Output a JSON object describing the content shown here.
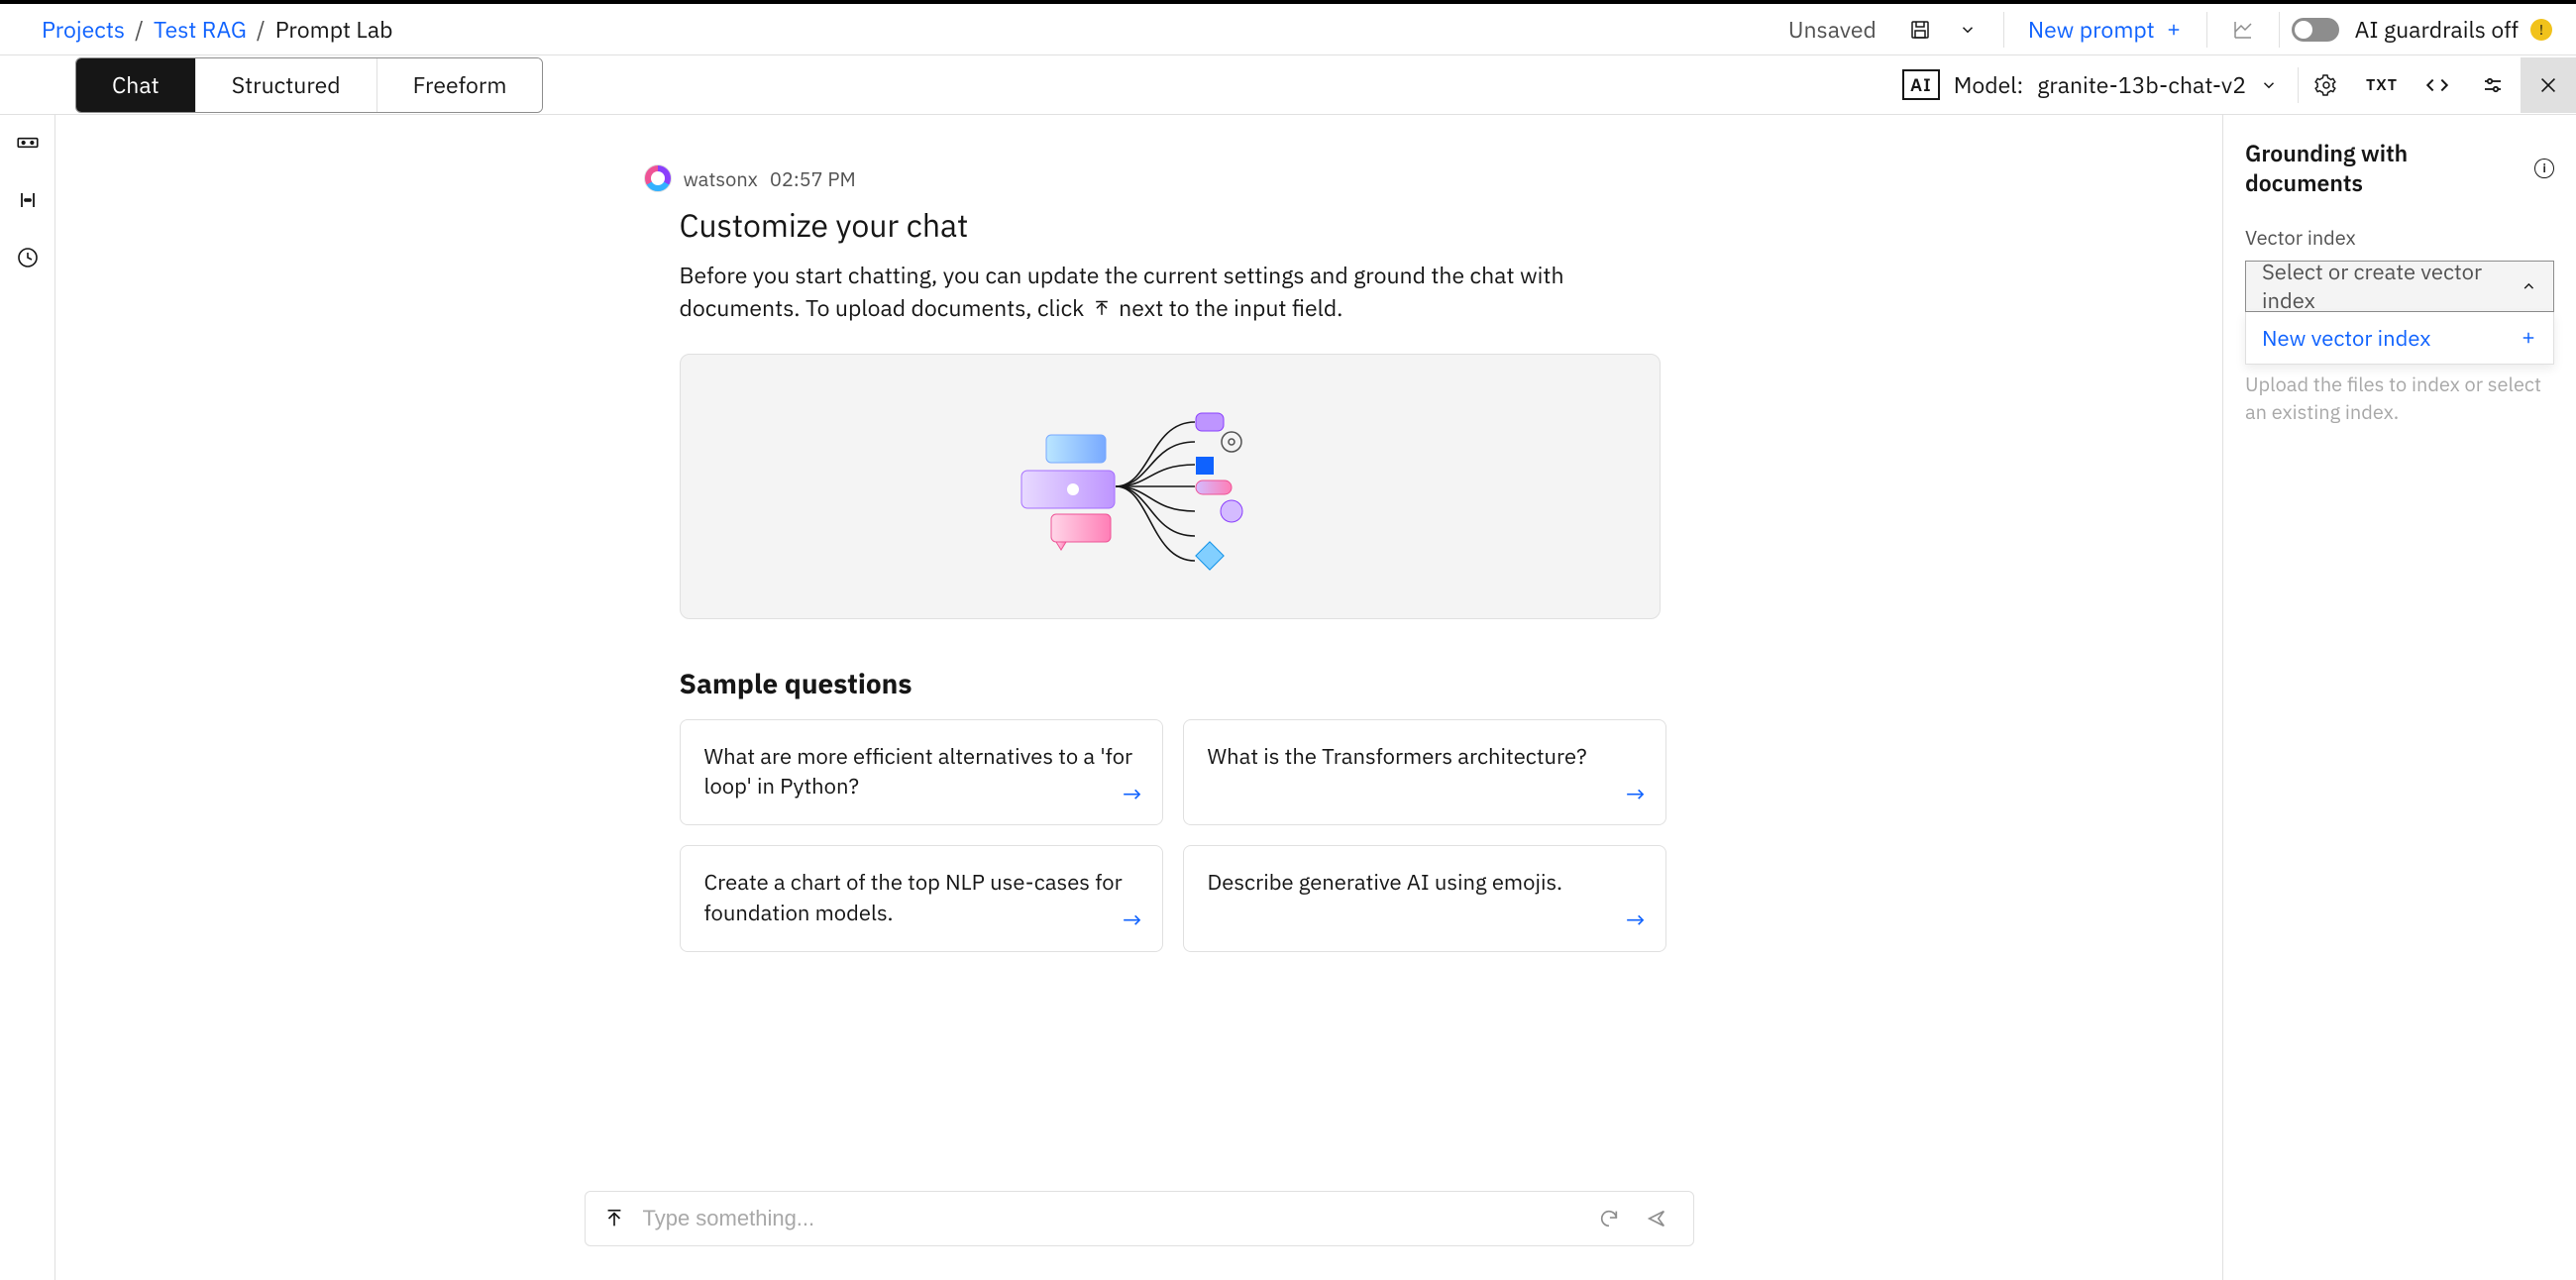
{
  "breadcrumb": {
    "projects": "Projects",
    "project_name": "Test RAG",
    "current": "Prompt Lab"
  },
  "topbar": {
    "unsaved": "Unsaved",
    "new_prompt": "New prompt",
    "guardrails_label": "AI guardrails off"
  },
  "modes": {
    "chat": "Chat",
    "structured": "Structured",
    "freeform": "Freeform"
  },
  "model": {
    "prefix": "Model:",
    "name": "granite-13b-chat-v2"
  },
  "chat": {
    "sender": "watsonx",
    "time": "02:57 PM",
    "title": "Customize your chat",
    "body_before": "Before you start chatting, you can update the current settings and ground the chat with documents. To upload documents, click ",
    "body_after": " next to the input field."
  },
  "samples": {
    "title": "Sample questions",
    "items": [
      "What are more efficient alternatives to a 'for loop' in Python?",
      "What is the Transformers architecture?",
      "Create a chart of the top NLP use-cases for foundation models.",
      "Describe generative AI using emojis."
    ]
  },
  "input": {
    "placeholder": "Type something..."
  },
  "grounding": {
    "title": "Grounding with documents",
    "vector_label": "Vector index",
    "select_placeholder": "Select or create vector index",
    "new_index": "New vector index",
    "help": "Upload the files to index or select an existing index."
  },
  "toolbar2_icons": {
    "txt": "TXT"
  }
}
